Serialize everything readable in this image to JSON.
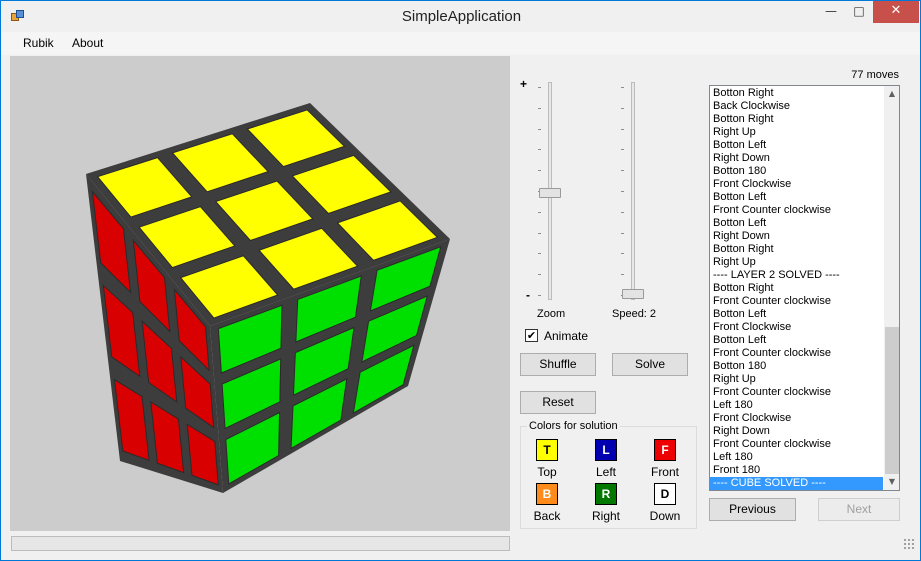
{
  "window": {
    "title": "SimpleApplication"
  },
  "titlebar": {
    "minimize": "—",
    "maximize": "□",
    "close": "✕"
  },
  "menu": {
    "items": [
      "Rubik",
      "About"
    ]
  },
  "cube": {
    "face_colors": {
      "top": "#ffff00",
      "front": "#00e000",
      "left": "#d80000",
      "edge": "#3d3d3d"
    }
  },
  "zoom": {
    "plus_label": "+",
    "minus_label": "-",
    "label": "Zoom",
    "level": 0.5
  },
  "speed": {
    "label": "Speed: 2",
    "level": 0.0
  },
  "animate": {
    "label": "Animate",
    "checked": true,
    "mark": "✔"
  },
  "buttons": {
    "shuffle": "Shuffle",
    "solve": "Solve",
    "reset": "Reset",
    "previous": "Previous",
    "next": "Next"
  },
  "colors_group": {
    "title": "Colors for solution",
    "items": [
      {
        "letter": "T",
        "label": "Top",
        "color": "#ffff00",
        "text_color": "#000000"
      },
      {
        "letter": "L",
        "label": "Left",
        "color": "#0000b0",
        "text_color": "#ffffff"
      },
      {
        "letter": "F",
        "label": "Front",
        "color": "#ee0000",
        "text_color": "#ffffff"
      },
      {
        "letter": "B",
        "label": "Back",
        "color": "#ff8c1a",
        "text_color": "#ffffff"
      },
      {
        "letter": "R",
        "label": "Right",
        "color": "#007800",
        "text_color": "#ffffff"
      },
      {
        "letter": "D",
        "label": "Down",
        "color": "#ffffff",
        "text_color": "#000000"
      }
    ]
  },
  "moves": {
    "count_label": "77 moves"
  },
  "move_list": {
    "items": [
      "Botton Right",
      "Back Clockwise",
      "Botton Right",
      "Right Up",
      "Botton Left",
      "Right Down",
      "Botton 180",
      "Front Clockwise",
      "Botton Left",
      "Front Counter clockwise",
      "Botton Left",
      "Right Down",
      "Botton Right",
      "Right Up",
      "---- LAYER 2 SOLVED ----",
      "Botton Right",
      "Front Counter clockwise",
      "Botton Left",
      "Front Clockwise",
      "Botton Left",
      "Front Counter clockwise",
      "Botton 180",
      "Right Up",
      "Front Counter clockwise",
      "Left 180",
      "Front Clockwise",
      "Right Down",
      "Front Counter clockwise",
      "Left 180",
      "Front 180",
      "---- CUBE SOLVED ----"
    ],
    "selected_index": 30
  }
}
